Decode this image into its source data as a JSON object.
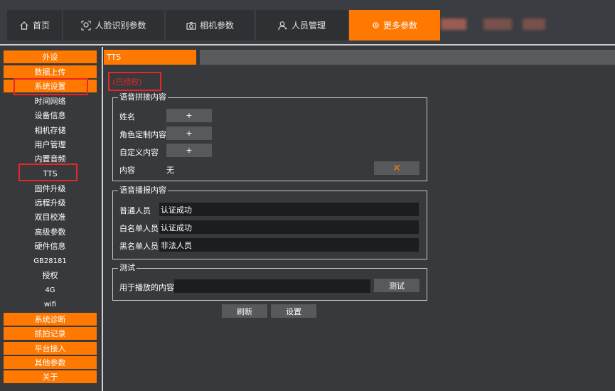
{
  "nav": {
    "tabs": [
      {
        "label": "首页",
        "icon": "home-icon"
      },
      {
        "label": "人脸识别参数",
        "icon": "face-icon"
      },
      {
        "label": "相机参数",
        "icon": "camera-icon"
      },
      {
        "label": "人员管理",
        "icon": "user-icon"
      },
      {
        "label": "更多参数",
        "icon": "settings-icon"
      }
    ],
    "accent": "#ff7800"
  },
  "sidebar": {
    "top_buttons": [
      "外设",
      "数据上传",
      "系统设置"
    ],
    "sub_items": [
      "时间网络",
      "设备信息",
      "相机存储",
      "用户管理",
      "内置音频",
      "TTS",
      "固件升级",
      "远程升级",
      "双目校准",
      "高级参数",
      "硬件信息",
      "GB28181",
      "授权",
      "4G",
      "wifi"
    ],
    "bottom_buttons": [
      "系统诊断",
      "抓拍记录",
      "平台接入",
      "其他参数",
      "关于"
    ]
  },
  "main": {
    "tab_label": "TTS",
    "auth_status": "(已授权)",
    "splice": {
      "legend": "语音拼接内容",
      "rows": [
        {
          "label": "姓名",
          "button": "+"
        },
        {
          "label": "角色定制内容",
          "button": "+"
        },
        {
          "label": "自定义内容",
          "button": "+"
        }
      ],
      "content_label": "内容",
      "content_value": "无",
      "clear_button": "✕"
    },
    "broadcast": {
      "legend": "语音播报内容",
      "rows": [
        {
          "label": "普通人员",
          "value": "认证成功"
        },
        {
          "label": "白名单人员",
          "value": "认证成功"
        },
        {
          "label": "黑名单人员",
          "value": "非法人员"
        }
      ]
    },
    "test": {
      "legend": "测试",
      "label": "用于播放的内容",
      "value": "",
      "button": "测试"
    },
    "refresh_button": "刷新",
    "set_button": "设置"
  }
}
